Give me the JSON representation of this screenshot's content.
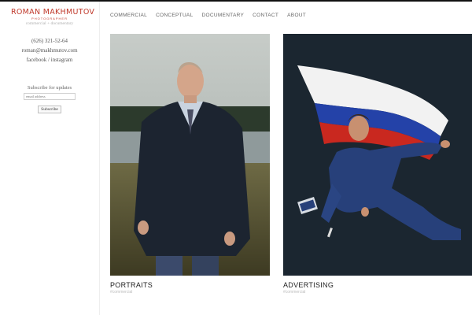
{
  "brand": {
    "name": "ROMAN MAKHMUTOV",
    "sub": "PHOTOGRAPHER",
    "tagline": "commercial + documentary"
  },
  "contact": {
    "phone": "(626) 321-52-64",
    "email": "roman@makhmutov.com",
    "facebook": "facebook",
    "separator": "/",
    "instagram": "instagram"
  },
  "subscribe": {
    "label": "Subscribe for updates",
    "placeholder": "email address",
    "button": "Subscribe"
  },
  "nav": [
    "COMMERCIAL",
    "CONCEPTUAL",
    "DOCUMENTARY",
    "CONTACT",
    "ABOUT"
  ],
  "tiles": [
    {
      "title": "PORTRAITS",
      "category": "#commercial"
    },
    {
      "title": "ADVERTISING",
      "category": "#commercial"
    }
  ],
  "colors": {
    "accent": "#c0392b",
    "text": "#333333"
  }
}
